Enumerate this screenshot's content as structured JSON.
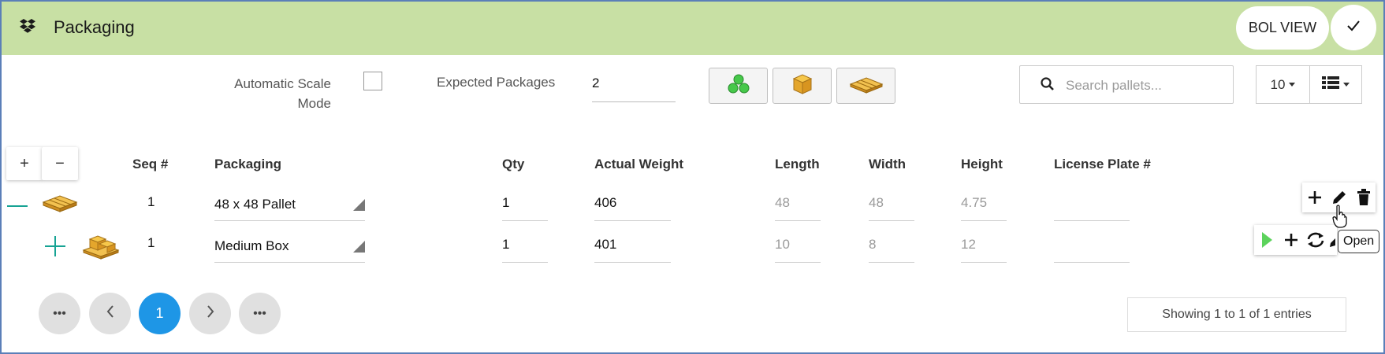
{
  "header": {
    "title": "Packaging",
    "bol_view_label": "BOL VIEW",
    "background_color": "#c8e0a4",
    "icon": "dropbox-icon"
  },
  "toolbar": {
    "automatic_scale_mode_label": "Automatic Scale Mode",
    "automatic_scale_mode_checked": false,
    "expected_packages_label": "Expected Packages",
    "expected_packages_value": "2",
    "package_type_buttons": [
      "green-bundle-icon",
      "box-icon",
      "pallet-icon"
    ],
    "search_placeholder": "Search pallets...",
    "page_size": "10",
    "view_icon": "list-view-icon"
  },
  "expand_controls": {
    "expand_label": "+",
    "collapse_label": "−"
  },
  "table": {
    "columns": {
      "seq": "Seq #",
      "packaging": "Packaging",
      "qty": "Qty",
      "weight": "Actual Weight",
      "length": "Length",
      "width": "Width",
      "height": "Height",
      "license": "License Plate #"
    },
    "rows": [
      {
        "seq": "1",
        "packaging": "48 x 48 Pallet",
        "qty": "1",
        "weight": "406",
        "length": "48",
        "width": "48",
        "height": "4.75",
        "license": "",
        "toggle": "collapse-icon",
        "icon": "pallet-icon"
      },
      {
        "seq": "1",
        "packaging": "Medium Box",
        "qty": "1",
        "weight": "401",
        "length": "10",
        "width": "8",
        "height": "12",
        "license": "",
        "toggle": "expand-icon",
        "icon": "boxes-on-pallet-icon"
      }
    ]
  },
  "tooltip": {
    "text": "Open"
  },
  "pagination": {
    "first": "•••",
    "current": "1",
    "last": "•••",
    "active_color": "#1e96e6",
    "info": "Showing 1 to 1 of 1 entries"
  },
  "colors": {
    "accent_teal": "#17a394",
    "play_green": "#5cd35c"
  }
}
